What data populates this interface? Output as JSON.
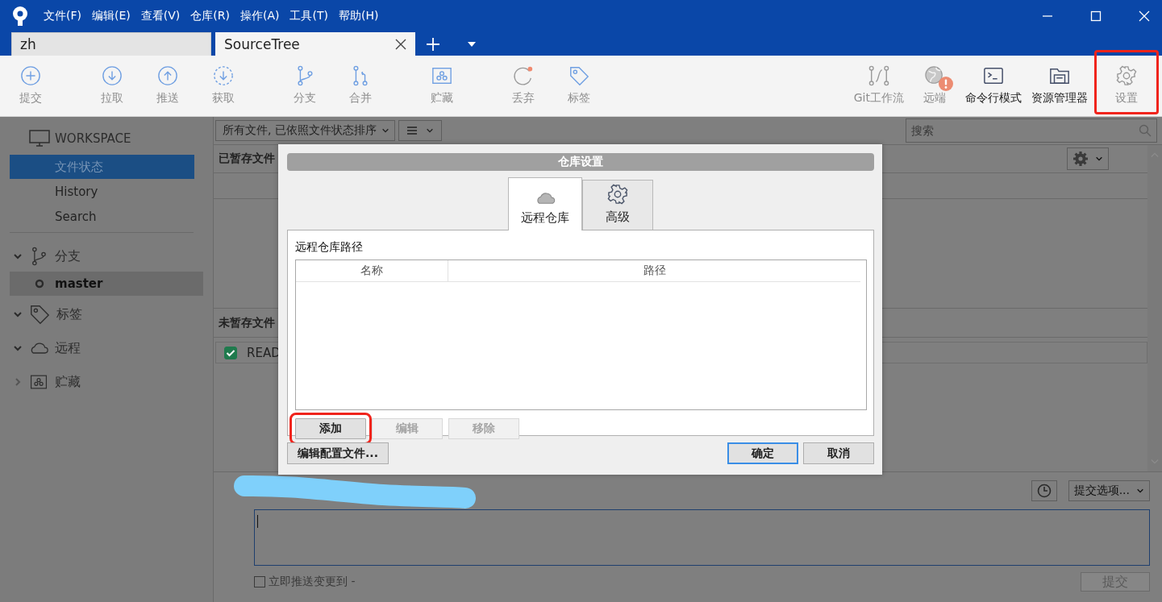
{
  "menu": [
    "文件(F)",
    "编辑(E)",
    "查看(V)",
    "仓库(R)",
    "操作(A)",
    "工具(T)",
    "帮助(H)"
  ],
  "tabs": [
    {
      "label": "zh",
      "selected": false,
      "closable": false
    },
    {
      "label": "SourceTree",
      "selected": true,
      "closable": true
    }
  ],
  "toolbar": {
    "groups": [
      {
        "items": [
          {
            "label": "提交",
            "disabled": true
          }
        ]
      },
      {
        "items": [
          {
            "label": "拉取",
            "disabled": true
          },
          {
            "label": "推送",
            "disabled": true
          },
          {
            "label": "获取",
            "disabled": true
          }
        ]
      },
      {
        "items": [
          {
            "label": "分支",
            "disabled": true
          },
          {
            "label": "合并",
            "disabled": true
          }
        ]
      },
      {
        "items": [
          {
            "label": "贮藏",
            "disabled": true
          }
        ]
      },
      {
        "items": [
          {
            "label": "丢弃",
            "disabled": true
          },
          {
            "label": "标签",
            "disabled": true
          }
        ]
      }
    ],
    "right": [
      {
        "label": "Git工作流",
        "disabled": true,
        "alert": false,
        "highlighted": false
      },
      {
        "label": "远端",
        "disabled": true,
        "alert": true,
        "highlighted": false
      },
      {
        "label": "命令行模式",
        "disabled": false,
        "alert": false,
        "highlighted": false
      },
      {
        "label": "资源管理器",
        "disabled": false,
        "alert": false,
        "highlighted": false
      },
      {
        "label": "设置",
        "disabled": true,
        "alert": false,
        "highlighted": true
      }
    ]
  },
  "sidebar": {
    "workspace": {
      "title": "WORKSPACE",
      "items": [
        {
          "label": "文件状态",
          "selected": true
        },
        {
          "label": "History",
          "selected": false
        },
        {
          "label": "Search",
          "selected": false
        }
      ]
    },
    "groups": [
      {
        "label": "分支",
        "expanded": true,
        "children": [
          {
            "label": "master",
            "selected": true
          }
        ]
      },
      {
        "label": "标签",
        "expanded": true
      },
      {
        "label": "远程",
        "expanded": true
      },
      {
        "label": "贮藏",
        "expanded": false
      }
    ]
  },
  "file_filter": {
    "value": "所有文件, 已依照文件状态排序"
  },
  "search": {
    "placeholder": "搜索"
  },
  "staged": {
    "title": "已暂存文件"
  },
  "unstaged": {
    "title": "未暂存文件",
    "files": [
      {
        "name": "READ",
        "checked": true
      }
    ]
  },
  "commit": {
    "options": "提交选项...",
    "push_now": {
      "label": "立即推送变更到 -",
      "checked": false
    },
    "submit": {
      "label": "提交",
      "disabled": true
    }
  },
  "dialog": {
    "title": "仓库设置",
    "tabs": [
      {
        "label": "远程仓库",
        "selected": true
      },
      {
        "label": "高级",
        "selected": false
      }
    ],
    "section_label": "远程仓库路径",
    "table": {
      "columns": [
        "名称",
        "路径"
      ]
    },
    "buttons": [
      {
        "label": "添加",
        "disabled": false,
        "highlighted": true
      },
      {
        "label": "编辑",
        "disabled": true,
        "highlighted": false
      },
      {
        "label": "移除",
        "disabled": true,
        "highlighted": false
      }
    ],
    "edit_config": "编辑配置文件...",
    "footer_buttons": [
      {
        "label": "确定",
        "default": true
      },
      {
        "label": "取消",
        "default": false
      }
    ]
  }
}
